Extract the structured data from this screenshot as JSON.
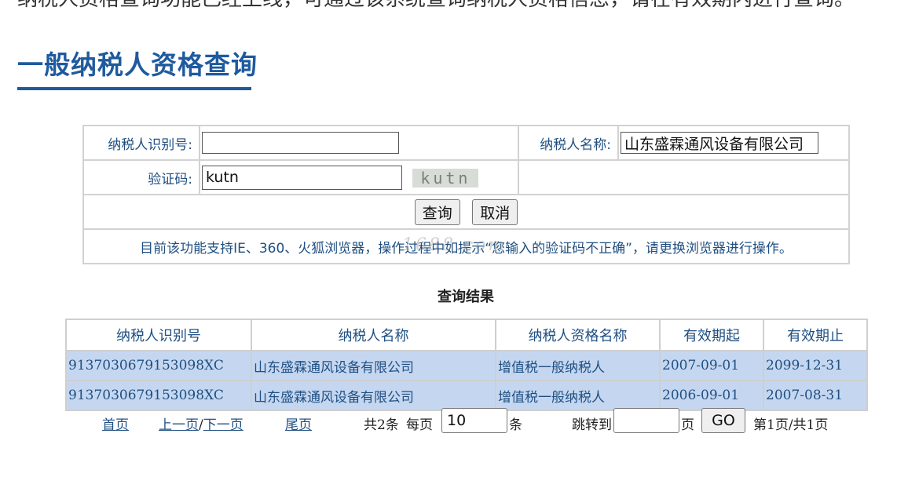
{
  "header": {
    "cut_text": "纳税人资格查询功能已经上线，可通过该系统查询纳税人资格信息，请在有效期内进行查询。",
    "title": "一般纳税人资格查询"
  },
  "form": {
    "taxpayer_id_label": "纳税人识别号:",
    "taxpayer_id_value": "",
    "taxpayer_name_label": "纳税人名称:",
    "taxpayer_name_value": "山东盛霖通风设备有限公司",
    "captcha_label": "验证码:",
    "captcha_value": "kutn",
    "captcha_image_text": "kutn",
    "query_button": "查询",
    "cancel_button": "取消",
    "notice": "目前该功能支持IE、360、火狐浏览器，操作过程中如提示“您输入的验证码不正确”，请更换浏览器进行操作。"
  },
  "watermark": "1688.com",
  "results": {
    "heading": "查询结果",
    "columns": [
      "纳税人识别号",
      "纳税人名称",
      "纳税人资格名称",
      "有效期起",
      "有效期止"
    ],
    "rows": [
      [
        "9137030679153098XC",
        "山东盛霖通风设备有限公司",
        "增值税一般纳税人",
        "2007-09-01",
        "2099-12-31"
      ],
      [
        "9137030679153098XC",
        "山东盛霖通风设备有限公司",
        "增值税一般纳税人",
        "2006-09-01",
        "2007-08-31"
      ]
    ]
  },
  "pager": {
    "first": "首页",
    "prev": "上一页",
    "separator": "/",
    "next": "下一页",
    "last": "尾页",
    "total": "共2条",
    "per_page_label": "每页",
    "per_page_value": "10",
    "per_page_unit": "条",
    "jump_label": "跳转到",
    "jump_value": "",
    "jump_unit": "页",
    "go_button": "GO",
    "page_info": "第1页/共1页"
  },
  "colors": {
    "title_blue": "#1f5a9e",
    "text_blue": "#1f4f82",
    "row_highlight": "#c5d7f0",
    "border_gray": "#d2d2d2"
  }
}
